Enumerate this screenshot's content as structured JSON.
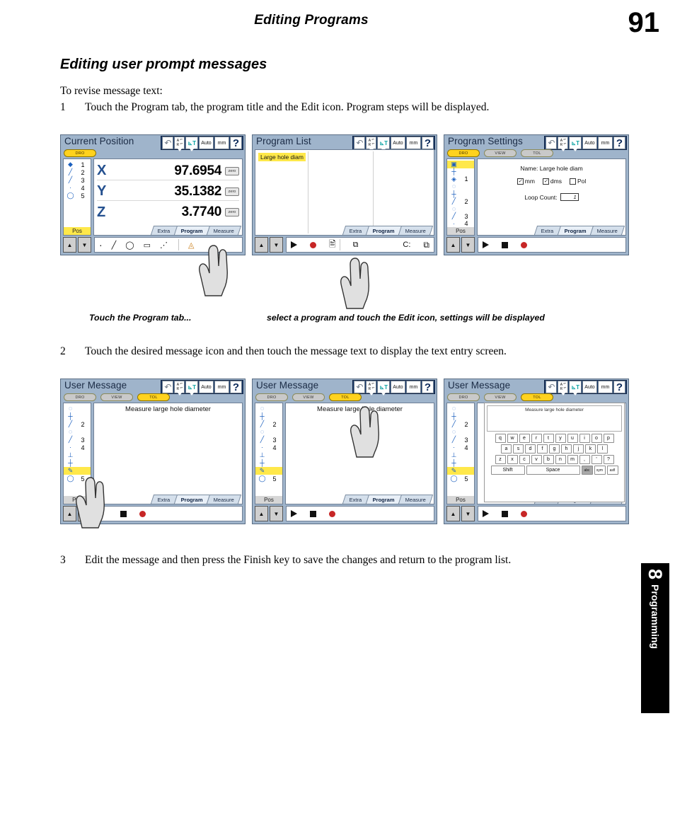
{
  "page": {
    "running_head": "Editing Programs",
    "page_number": "91",
    "section_title": "Editing user prompt messages",
    "intro": "To revise message text:",
    "steps": [
      {
        "num": "1",
        "text": "Touch the Program tab, the program title and the Edit icon. Program steps will be displayed."
      },
      {
        "num": "2",
        "text": "Touch the desired message icon and then touch the message text to display the text entry screen."
      },
      {
        "num": "3",
        "text": "Edit the message and then press the Finish key to save the changes and return to the program list."
      }
    ],
    "captions": [
      "Touch the Program tab...",
      "select a program and touch the Edit icon, settings will be displayed"
    ],
    "side_tab": {
      "number": "8",
      "label": "Programming"
    }
  },
  "toolbar": {
    "undo": "↶",
    "ar_top": "A    °\"",
    "ar_bot": "R    °\"",
    "axis": "T",
    "auto": "Auto",
    "units": "mm",
    "help": "?"
  },
  "tabs": [
    {
      "label": "Extra",
      "active": false
    },
    {
      "label": "Program",
      "active": true
    },
    {
      "label": "Measure",
      "active": false
    }
  ],
  "pills": {
    "dro": "DRO",
    "view": "VIEW",
    "tol": "TOL",
    "pos": "Pos"
  },
  "shot1": {
    "title": "Current Position",
    "axes": [
      {
        "label": "X",
        "value": "97.6954",
        "zero": "zero"
      },
      {
        "label": "Y",
        "value": "35.1382",
        "zero": "zero"
      },
      {
        "label": "Z",
        "value": "3.7740",
        "zero": "zero"
      }
    ],
    "rail": [
      {
        "glyph": "◆",
        "num": "1"
      },
      {
        "glyph": "╱",
        "num": "2"
      },
      {
        "glyph": "╱",
        "num": "3"
      },
      {
        "glyph": "·",
        "num": "4"
      },
      {
        "glyph": "◯",
        "num": "5"
      }
    ],
    "bottom_icons": [
      "·",
      "╱",
      "◯",
      "▭",
      "⋰",
      "◬"
    ]
  },
  "shot2": {
    "title": "Program List",
    "item": "Large hole diam",
    "drive_label": "C:",
    "bottom_icons": [
      "play",
      "record",
      "edit",
      "copy"
    ]
  },
  "shot3": {
    "title": "Program Settings",
    "name_label": "Name: Large hole diam",
    "checks": [
      {
        "label": "mm",
        "checked": true
      },
      {
        "label": "dms",
        "checked": true
      },
      {
        "label": "Pol",
        "checked": false
      }
    ],
    "loop_label": "Loop Count:",
    "loop_value": "1",
    "rail": [
      {
        "glyph": "▣",
        "num": ""
      },
      {
        "glyph": "┼",
        "num": ""
      },
      {
        "glyph": "◈",
        "num": "1"
      },
      {
        "glyph": "◌",
        "num": ""
      },
      {
        "glyph": "┼",
        "num": ""
      },
      {
        "glyph": "╱",
        "num": "2"
      },
      {
        "glyph": "◌",
        "num": ""
      },
      {
        "glyph": "╱",
        "num": "3"
      },
      {
        "glyph": "·",
        "num": "4"
      },
      {
        "glyph": "┼",
        "num": ""
      }
    ]
  },
  "shot4": {
    "title": "User Message",
    "message": "Measure large hole diameter",
    "rail": [
      {
        "glyph": "◌",
        "num": ""
      },
      {
        "glyph": "┼",
        "num": ""
      },
      {
        "glyph": "╱",
        "num": "2"
      },
      {
        "glyph": "◌",
        "num": ""
      },
      {
        "glyph": "╱",
        "num": "3"
      },
      {
        "glyph": "·",
        "num": "4"
      },
      {
        "glyph": "⊥",
        "num": ""
      },
      {
        "glyph": "┼",
        "num": ""
      },
      {
        "glyph": "✎",
        "num": ""
      },
      {
        "glyph": "◯",
        "num": "5"
      }
    ]
  },
  "shot5": {
    "title": "User Message",
    "message": "Measure large hole diameter"
  },
  "shot6": {
    "title": "User Message",
    "message": "Measure large hole diameter",
    "keyboard": {
      "row1": [
        "q",
        "w",
        "e",
        "r",
        "t",
        "y",
        "u",
        "i",
        "o",
        "p"
      ],
      "row2": [
        "a",
        "s",
        "d",
        "f",
        "g",
        "h",
        "j",
        "k",
        "l"
      ],
      "row3": [
        "z",
        "x",
        "c",
        "v",
        "b",
        "n",
        "m",
        ",",
        "'",
        "?"
      ],
      "shift": "Shift",
      "space": "Space",
      "modes": [
        "abc",
        "sym",
        "asfl"
      ]
    }
  }
}
